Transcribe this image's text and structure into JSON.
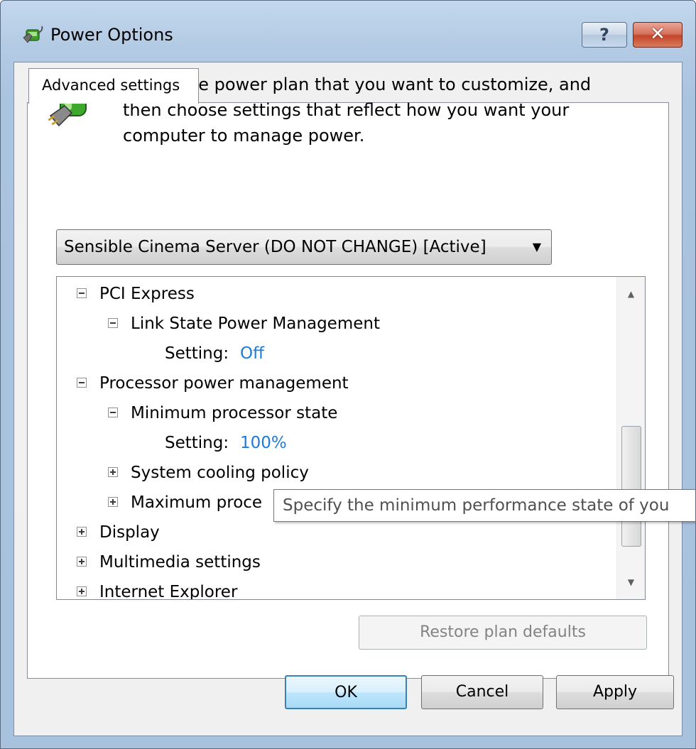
{
  "window": {
    "title": "Power Options",
    "help_glyph": "?",
    "close_glyph": "✕",
    "icons": {
      "app": "power-options-icon",
      "help": "help-icon",
      "close": "close-icon"
    }
  },
  "tab": {
    "label": "Advanced settings"
  },
  "description": "Select the power plan that you want to customize, and then choose settings that reflect how you want your computer to manage power.",
  "plan_selector": {
    "selected": "Sensible Cinema Server (DO NOT CHANGE) [Active]",
    "arrow": "▼"
  },
  "settings_tree": {
    "items": [
      {
        "label": "PCI Express",
        "state": "expanded"
      },
      {
        "label": "Link State Power Management",
        "state": "expanded"
      },
      {
        "label": "Setting:",
        "value": "Off"
      },
      {
        "label": "Processor power management",
        "state": "expanded"
      },
      {
        "label": "Minimum processor state",
        "state": "expanded"
      },
      {
        "label": "Setting:",
        "value": "100%"
      },
      {
        "label": "System cooling policy",
        "state": "collapsed"
      },
      {
        "label": "Maximum proce",
        "state": "collapsed"
      },
      {
        "label": "Display",
        "state": "collapsed"
      },
      {
        "label": "Multimedia settings",
        "state": "collapsed"
      },
      {
        "label": "Internet Explorer",
        "state": "collapsed"
      }
    ],
    "scroll_up_glyph": "▲",
    "scroll_down_glyph": "▼"
  },
  "tooltip": {
    "text": "Specify the minimum performance state of you"
  },
  "buttons": {
    "restore": "Restore plan defaults",
    "ok": "OK",
    "cancel": "Cancel",
    "apply": "Apply"
  },
  "colors": {
    "setting_value": "#1e7bd8",
    "disabled_text": "#838383",
    "title_bar": "#b4cbe4"
  }
}
